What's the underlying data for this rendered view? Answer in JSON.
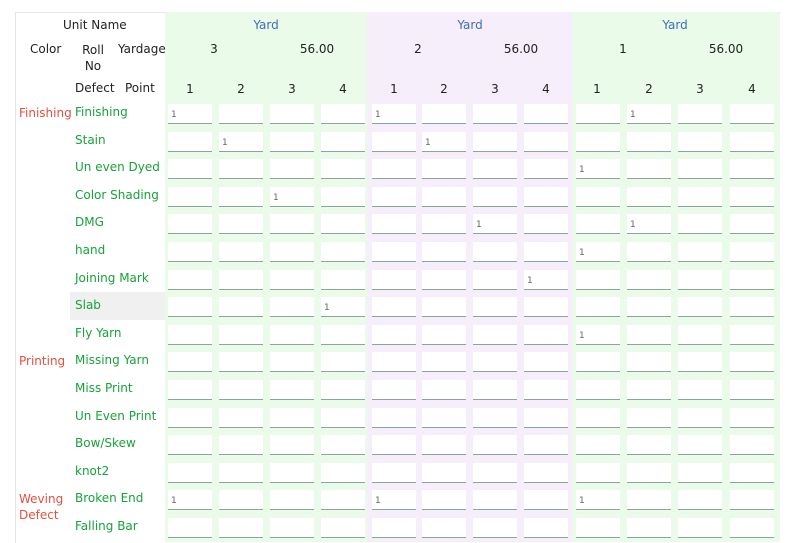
{
  "header": {
    "unit_name_label": "Unit Name",
    "color_label": "Color",
    "roll_no_label": "Roll\nNo",
    "yardage_label": "Yardage",
    "defect_label": "Defect",
    "point_label": "Point"
  },
  "groups": [
    {
      "unit": "Yard",
      "roll_no": "3",
      "yardage": "56.00",
      "points": [
        "1",
        "2",
        "3",
        "4"
      ],
      "bg": "#eafbea"
    },
    {
      "unit": "Yard",
      "roll_no": "2",
      "yardage": "56.00",
      "points": [
        "1",
        "2",
        "3",
        "4"
      ],
      "bg": "#f6eefb"
    },
    {
      "unit": "Yard",
      "roll_no": "1",
      "yardage": "56.00",
      "points": [
        "1",
        "2",
        "3",
        "4"
      ],
      "bg": "#eafbea"
    }
  ],
  "rows": [
    {
      "category": "Finishing",
      "defect": "Finishing",
      "values": [
        "1",
        "",
        "",
        "",
        "1",
        "",
        "",
        "",
        "",
        "1",
        "",
        ""
      ]
    },
    {
      "category": "",
      "defect": "Stain",
      "values": [
        "",
        "1",
        "",
        "",
        "",
        "1",
        "",
        "",
        "",
        "",
        "",
        ""
      ]
    },
    {
      "category": "",
      "defect": "Un even Dyed",
      "values": [
        "",
        "",
        "",
        "",
        "",
        "",
        "",
        "",
        "1",
        "",
        "",
        ""
      ]
    },
    {
      "category": "",
      "defect": "Color Shading",
      "values": [
        "",
        "",
        "1",
        "",
        "",
        "",
        "",
        "",
        "",
        "",
        "",
        ""
      ]
    },
    {
      "category": "",
      "defect": "DMG",
      "values": [
        "",
        "",
        "",
        "",
        "",
        "",
        "1",
        "",
        "",
        "1",
        "",
        ""
      ]
    },
    {
      "category": "",
      "defect": "hand",
      "values": [
        "",
        "",
        "",
        "",
        "",
        "",
        "",
        "",
        "1",
        "",
        "",
        ""
      ]
    },
    {
      "category": "",
      "defect": "Joining Mark",
      "values": [
        "",
        "",
        "",
        "",
        "",
        "",
        "",
        "1",
        "",
        "",
        "",
        ""
      ]
    },
    {
      "category": "",
      "defect": "Slab",
      "values": [
        "",
        "",
        "",
        "1",
        "",
        "",
        "",
        "",
        "",
        "",
        "",
        ""
      ]
    },
    {
      "category": "",
      "defect": "Fly Yarn",
      "values": [
        "",
        "",
        "",
        "",
        "",
        "",
        "",
        "",
        "1",
        "",
        "",
        ""
      ]
    },
    {
      "category": "Printing",
      "defect": "Missing Yarn",
      "values": [
        "",
        "",
        "",
        "",
        "",
        "",
        "",
        "",
        "",
        "",
        "",
        ""
      ]
    },
    {
      "category": "",
      "defect": "Miss Print",
      "values": [
        "",
        "",
        "",
        "",
        "",
        "",
        "",
        "",
        "",
        "",
        "",
        ""
      ]
    },
    {
      "category": "",
      "defect": "Un Even Print",
      "values": [
        "",
        "",
        "",
        "",
        "",
        "",
        "",
        "",
        "",
        "",
        "",
        ""
      ]
    },
    {
      "category": "",
      "defect": "Bow/Skew",
      "values": [
        "",
        "",
        "",
        "",
        "",
        "",
        "",
        "",
        "",
        "",
        "",
        ""
      ]
    },
    {
      "category": "",
      "defect": "knot2",
      "values": [
        "",
        "",
        "",
        "",
        "",
        "",
        "",
        "",
        "",
        "",
        "",
        ""
      ]
    },
    {
      "category": "Weving Defect",
      "defect": "Broken End",
      "values": [
        "1",
        "",
        "",
        "",
        "1",
        "",
        "",
        "",
        "1",
        "",
        "",
        ""
      ]
    },
    {
      "category": "",
      "defect": "Falling Bar",
      "values": [
        "",
        "",
        "",
        "",
        "",
        "",
        "",
        "",
        "",
        "",
        "",
        ""
      ]
    }
  ]
}
